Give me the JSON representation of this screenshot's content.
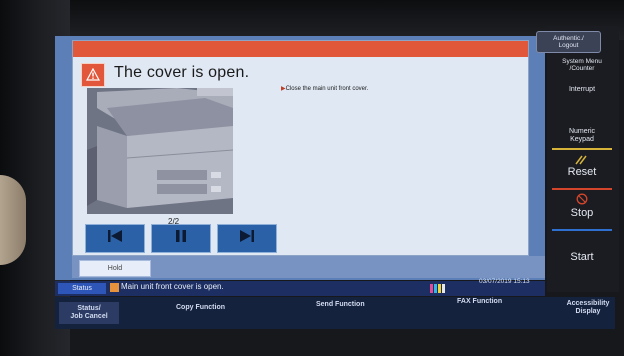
{
  "dialog": {
    "title": "The cover is open.",
    "instruction": "Close the main unit front cover.",
    "page_indicator": "2/2"
  },
  "controls": {
    "first_icon": "skip-back-icon",
    "pause_icon": "pause-icon",
    "next_icon": "skip-forward-icon"
  },
  "hold_label": "Hold",
  "status": {
    "label": "Status",
    "message": "Main unit front cover is open.",
    "datetime": "03/07/2019  15:13"
  },
  "functions": {
    "status_job_cancel": "Status/\nJob Cancel",
    "copy": "Copy Function",
    "send": "Send Function",
    "fax": "FAX Function",
    "accessibility": "Accessibility\nDisplay"
  },
  "right_panel": {
    "authentic_logout": "Authentic./\nLogout",
    "system_menu": "System Menu\n/Counter",
    "interrupt": "Interrupt",
    "numeric_keypad": "Numeric\nKeypad",
    "reset": "Reset",
    "stop": "Stop",
    "start": "Start"
  },
  "colors": {
    "alert": "#e0573a",
    "stop_red": "#d4462b",
    "start_blue": "#2f6fd0",
    "status_blue": "#2d56b8"
  }
}
